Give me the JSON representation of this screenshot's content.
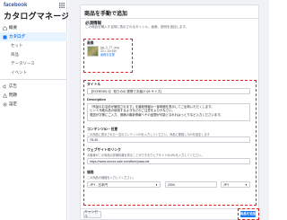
{
  "brand": "facebook",
  "app_title": "カタログマネージャ",
  "nav": {
    "overview": "概要",
    "catalog": "カタログ",
    "sets": "セット",
    "items": "商品",
    "data_sources": "データソース",
    "events": "イベント",
    "ads": "広告",
    "issues": "問題",
    "settings": "設定"
  },
  "panel": {
    "title": "商品を手動で追加",
    "required_label": "必須情報",
    "required_desc_1": "この商品を購入する際に表示されるタイトル、画像、説明を追加します。",
    "required_desc_2": "",
    "image_label": "画像",
    "image_meta": [
      "jpg_0_TT_aug",
      "20 × 16×160",
      "画像を変更"
    ]
  },
  "form": {
    "title_label": "タイトル",
    "title_value": "【ECRESIN 1】 知りのの 提携でお届け (M サイズ)",
    "description_label": "Description",
    "description_lines": [
      "「商品のお名前が解説されます」を最新情報の一部明細を表示してご出荷いただくします。",
      "ヒント冷蔵の品の使用するよきなどのご注意をよびかなさい。",
      "発送が次第にご入力、価格の最新情報へその品間が可能となれれはっとりなど入力くださいます。"
    ],
    "content_id_label": "コンテンツID・任意",
    "content_id_desc": "この商品に表示された一意のコンテンツIDを入力してください。商品に推奨したIDを設定します",
    "content_id_value": "78-49",
    "website_label": "ウェブサイトのリンク",
    "website_desc": "お客様がこの商品の詳細情報を見ることができるウェブサイトのURLを入力してください。",
    "website_value": "https://www.xxxxxx-sale.com/item/yaaa-xel",
    "price_label": "価格",
    "price_desc": "この商品の価格を入力してください。",
    "currency": "JPY - 日本円",
    "price_value": "2000",
    "price_unit": "JPY"
  },
  "footer": {
    "cancel": "キャンセル",
    "add": "商品を追加"
  },
  "colors": {
    "accent": "#1877f2",
    "highlight": "#e02020"
  }
}
